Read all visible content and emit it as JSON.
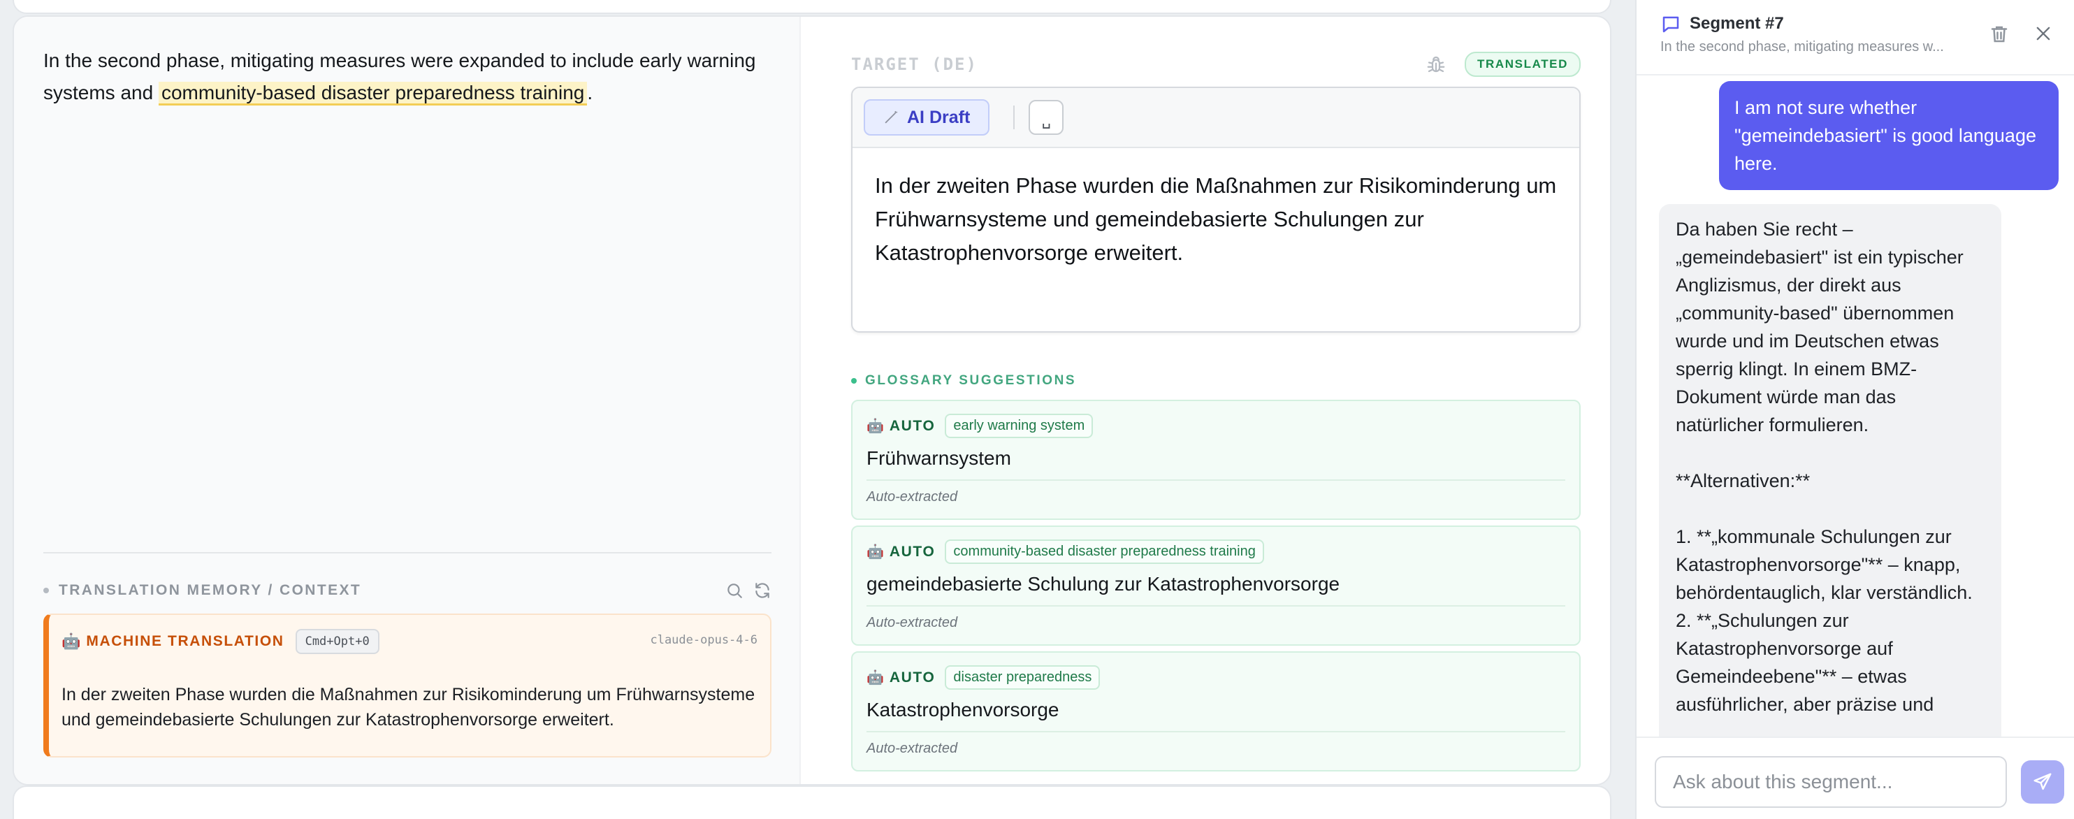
{
  "source": {
    "text_before": "In the second phase, mitigating measures were expanded to include early warning systems and ",
    "highlight": "community-based disaster preparedness training",
    "text_after": "."
  },
  "tm": {
    "title": "TRANSLATION MEMORY / CONTEXT",
    "icons": [
      "search-icon",
      "refresh-icon"
    ],
    "mt": {
      "emoji": "🤖",
      "label": "MACHINE TRANSLATION",
      "shortcut": "Cmd+Opt+0",
      "model": "claude-opus-4-6",
      "text": "In der zweiten Phase wurden die Maßnahmen zur Risikominderung um Frühwarnsysteme und gemeindebasierte Schulungen zur Katastrophenvorsorge erweitert."
    },
    "colors": {
      "accent": "#f07b1d",
      "label": "#c64f08"
    }
  },
  "target": {
    "label": "TARGET (DE)",
    "status": "TRANSLATED",
    "ai_draft": "AI Draft",
    "space_glyph": "␣",
    "text": "In der zweiten Phase wurden die Maßnahmen zur Risikominderung um Frühwarnsysteme und gemeindebasierte Schulungen zur Katastrophenvorsorge erweitert."
  },
  "glossary": {
    "title": "GLOSSARY SUGGESTIONS",
    "items": [
      {
        "emoji": "🤖",
        "type": "AUTO",
        "term": "early warning system",
        "translation": "Frühwarnsystem",
        "note": "Auto-extracted"
      },
      {
        "emoji": "🤖",
        "type": "AUTO",
        "term": "community-based disaster preparedness training",
        "translation": "gemeindebasierte Schulung zur Katastrophenvorsorge",
        "note": "Auto-extracted"
      },
      {
        "emoji": "🤖",
        "type": "AUTO",
        "term": "disaster preparedness",
        "translation": "Katastrophenvorsorge",
        "note": "Auto-extracted"
      }
    ]
  },
  "panel": {
    "title": "Segment #7",
    "subtitle": "In the second phase, mitigating measures w...",
    "messages": {
      "user": "I am not sure whether \"gemeindebasiert\" is good language here.",
      "assistant": "Da haben Sie recht – „gemeindebasiert\" ist ein typischer Anglizismus, der direkt aus „community-based\" übernommen wurde und im Deutschen etwas sperrig klingt. In einem BMZ-Dokument würde man das natürlicher formulieren.\n\n**Alternativen:**\n\n1. **„kommunale Schulungen zur Katastrophenvorsorge\"** – knapp, behördentauglich, klar verständlich.\n2. **„Schulungen zur Katastrophenvorsorge auf Gemeindeebene\"** – etwas ausführlicher, aber präzise und"
    },
    "input_placeholder": "Ask about this segment...",
    "colors": {
      "user_bubble": "#5b5cf0",
      "send": "#a9adf6"
    }
  }
}
